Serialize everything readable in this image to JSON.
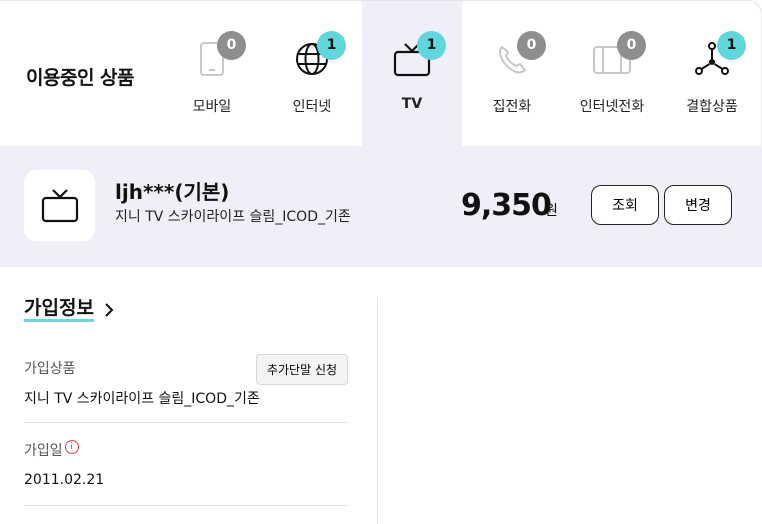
{
  "header": {
    "title": "이용중인 상품"
  },
  "tabs": [
    {
      "label": "모바일",
      "count": "0",
      "icon": "mobile-icon"
    },
    {
      "label": "인터넷",
      "count": "1",
      "icon": "globe-icon"
    },
    {
      "label": "TV",
      "count": "1",
      "icon": "tv-icon"
    },
    {
      "label": "집전화",
      "count": "0",
      "icon": "phone-icon"
    },
    {
      "label": "인터넷전화",
      "count": "0",
      "icon": "internet-phone-icon"
    },
    {
      "label": "결합상품",
      "count": "1",
      "icon": "bundle-icon"
    }
  ],
  "product": {
    "name": "ljh***(기본)",
    "description": "지니 TV 스카이라이프 슬림_ICOD_기존",
    "price": "9,350",
    "price_unit": "원",
    "view_label": "조회",
    "change_label": "변경"
  },
  "info": {
    "title": "가입정보",
    "product_label": "가입상품",
    "product_value": "지니 TV 스카이라이프 슬림_ICOD_기존",
    "add_device_label": "추가단말 신청",
    "join_date_label": "가입일",
    "join_date_value": "2011.02.21",
    "info_mark": "i"
  },
  "colors": {
    "accent": "#5fd7dc",
    "active_bg": "#eeeff9",
    "badge_gray": "#8e8e8e"
  }
}
